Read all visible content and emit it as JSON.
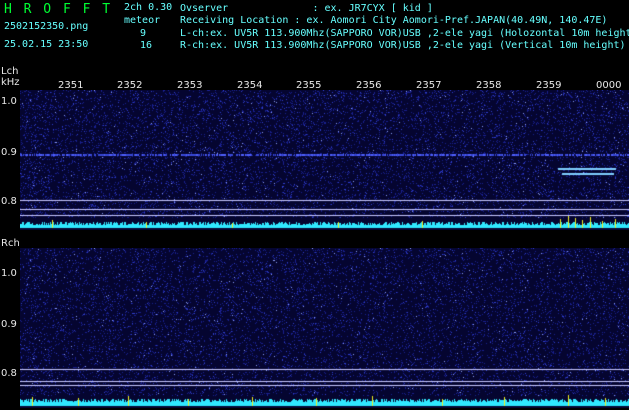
{
  "header": {
    "app_title": "H R O F F T",
    "version": "2ch 0.30",
    "filename": "2502152350.png",
    "datetime": "25.02.15 23:50",
    "meteor_label": "meteor",
    "lch_count": "9",
    "rch_count": "16",
    "observer_line": "Ovserver              : ex. JR7CYX [ kid ]",
    "location_line": "Receiving Location : ex. Aomori City Aomori-Pref.JAPAN(40.49N, 140.47E)",
    "lch_line": "L-ch:ex. UV5R 113.900Mhz(SAPPORO VOR)USB ,2-ele yagi (Holozontal 10m height)",
    "rch_line": "R-ch:ex. UV5R 113.900Mhz(SAPPORO VOR)USB ,2-ele yagi (Vertical 10m height)"
  },
  "time_ticks": [
    "2351",
    "2352",
    "2353",
    "2354",
    "2355",
    "2356",
    "2357",
    "2358",
    "2359",
    "0000"
  ],
  "lch": {
    "label": "Lch",
    "unit": "kHz",
    "y_ticks": [
      "1.0",
      "0.9",
      "0.8"
    ]
  },
  "rch": {
    "label": "Rch",
    "y_ticks": [
      "1.0",
      "0.9",
      "0.8"
    ]
  },
  "colors": {
    "background": "#000000",
    "title_green": "#00ff33",
    "header_cyan": "#66ffff",
    "text_white": "#e8e8e8",
    "spectrum_blue": "#1a2aa0",
    "signal_cyan": "#30e8ff",
    "meteor_yellow": "#f0f020"
  }
}
